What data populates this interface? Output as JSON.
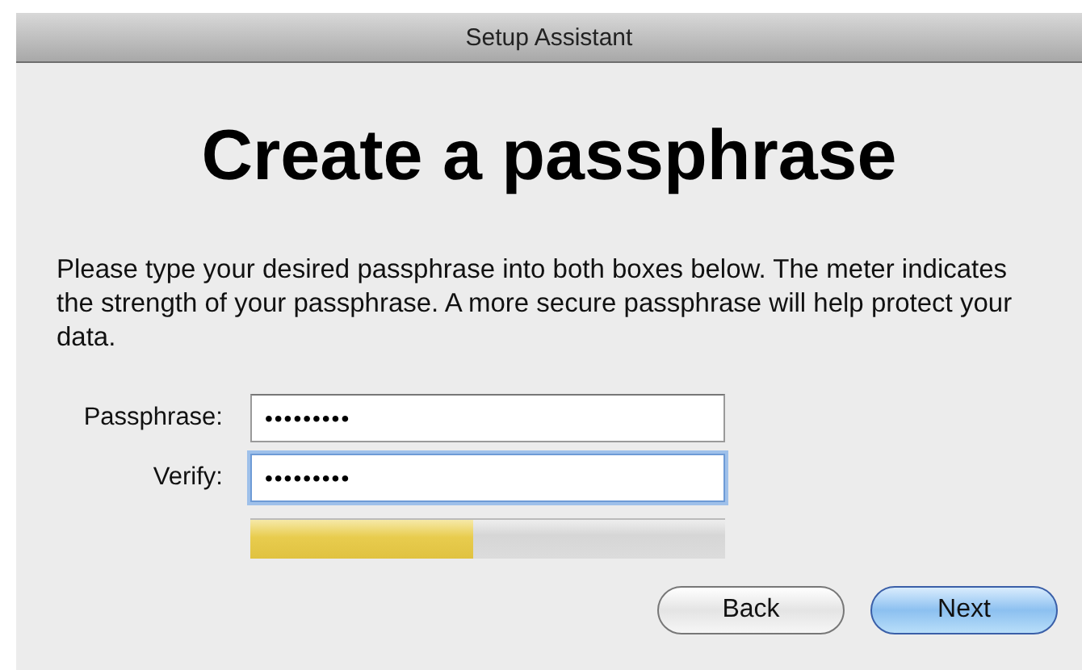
{
  "window": {
    "title": "Setup Assistant"
  },
  "heading": "Create a passphrase",
  "description": "Please type your desired passphrase into both boxes below.  The meter indicates the strength of your passphrase.  A more secure passphrase will help protect your data.",
  "fields": [
    {
      "label": "Passphrase:",
      "value": "•••••••••",
      "focused": false
    },
    {
      "label": "Verify:",
      "value": "•••••••••",
      "focused": true
    }
  ],
  "strength_meter": {
    "level": 0.47
  },
  "buttons": [
    {
      "label": "Back",
      "default": false
    },
    {
      "label": "Next",
      "default": true
    }
  ]
}
